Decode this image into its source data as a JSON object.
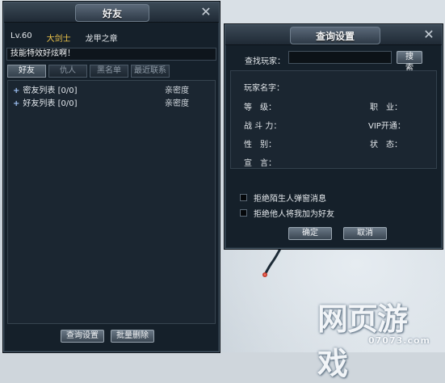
{
  "friends_window": {
    "title": "好友",
    "level": "Lv.60",
    "class_name": "大剑士",
    "player_title": "龙甲之章",
    "signature": "技能特效好炫啊！",
    "tabs": [
      {
        "label": "好友",
        "active": true
      },
      {
        "label": "仇人",
        "active": false
      },
      {
        "label": "黑名单",
        "active": false
      },
      {
        "label": "最近联系",
        "active": false
      }
    ],
    "groups": [
      {
        "name": "密友列表 [0/0]",
        "intimacy_label": "亲密度"
      },
      {
        "name": "好友列表 [0/0]",
        "intimacy_label": "亲密度"
      }
    ],
    "buttons": {
      "query_settings": "查询设置",
      "batch_delete": "批量删除"
    }
  },
  "query_window": {
    "title": "查询设置",
    "find_player_label": "查找玩家：",
    "find_player_value": "",
    "search_button": "搜索",
    "fields": {
      "player_name": "玩家名字：",
      "level": "等　级：",
      "guild_power": "战 斗 力：",
      "gender": "性　别：",
      "motto": "宣　言：",
      "job": "职　业：",
      "vip": "VIP开通：",
      "status": "状　态："
    },
    "options": [
      {
        "label": "拒绝陌生人弹窗消息",
        "checked": false
      },
      {
        "label": "拒绝他人将我加为好友",
        "checked": false
      }
    ],
    "ok_button": "确定",
    "cancel_button": "取消"
  },
  "watermark": {
    "main": "网页游戏",
    "sub": "07073.com"
  },
  "colors": {
    "class_gold": "#f2c84b",
    "window_bg": "#15202a",
    "panel_bg": "#1b2631"
  }
}
